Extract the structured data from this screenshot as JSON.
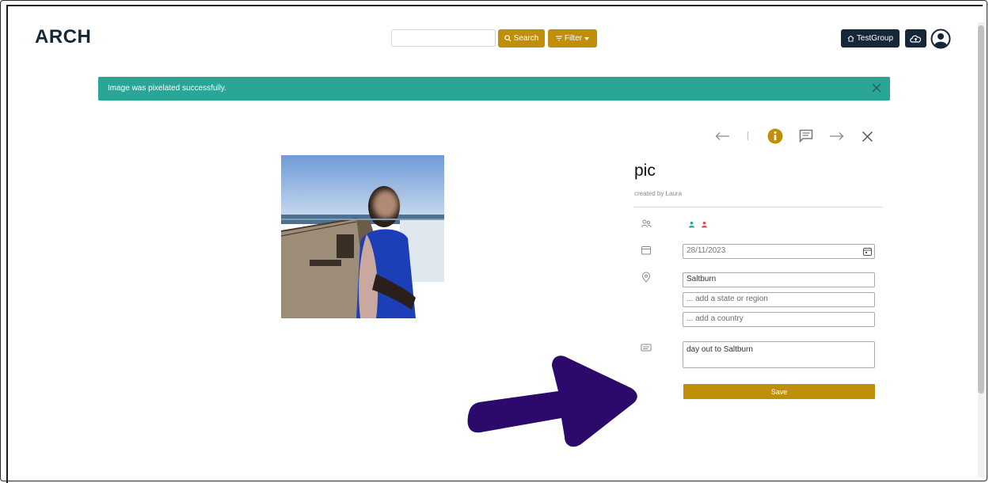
{
  "header": {
    "logo": "ARCH",
    "search_value": "",
    "search_label": "Search",
    "filter_label": "Filter",
    "group_label": "TestGroup"
  },
  "alert": {
    "message": "Image was pixelated successfully."
  },
  "detail": {
    "title": "pic",
    "created_by": "created by Laura",
    "date": "28/11/2023",
    "location_city": "Saltburn",
    "location_region_placeholder": "... add a state or region",
    "location_country_placeholder": "... add a country",
    "description": "day out to Saltburn",
    "save_label": "Save"
  },
  "colors": {
    "brand_dark": "#17273a",
    "accent_gold": "#c08f09",
    "alert_teal": "#2ba596",
    "annotation_arrow": "#2b0a6b"
  },
  "icons": [
    "search-icon",
    "filter-icon",
    "home-icon",
    "cloud-upload-icon",
    "user-avatar-icon",
    "close-icon",
    "arrow-left-icon",
    "info-icon",
    "comment-icon",
    "arrow-right-icon",
    "people-icon",
    "calendar-icon",
    "location-pin-icon",
    "caption-icon"
  ]
}
